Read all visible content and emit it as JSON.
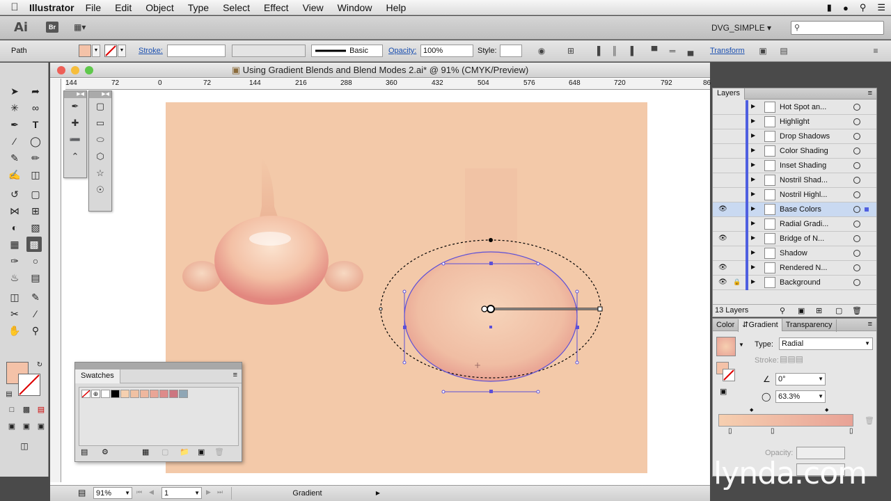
{
  "menubar": {
    "app_name": "Illustrator",
    "items": [
      "File",
      "Edit",
      "Object",
      "Type",
      "Select",
      "Effect",
      "View",
      "Window",
      "Help"
    ]
  },
  "appbar": {
    "logo": "Ai",
    "bridge": "Br",
    "workspace": "DVG_SIMPLE"
  },
  "controlbar": {
    "selection": "Path",
    "stroke_label": "Stroke:",
    "brush": "Basic",
    "opacity_label": "Opacity:",
    "opacity_value": "100%",
    "style_label": "Style:",
    "transform_label": "Transform",
    "fill_color": "#f4c2a8"
  },
  "document": {
    "title": "Using Gradient Blends and Blend Modes 2.ai* @ 91% (CMYK/Preview)",
    "ruler_ticks": [
      "144",
      "72",
      "0",
      "72",
      "144",
      "216",
      "288",
      "360",
      "432",
      "504",
      "576",
      "648",
      "720",
      "792",
      "86"
    ],
    "zoom": "91%",
    "artboard_num": "1",
    "status": "Gradient",
    "artboard_color": "#f3c9a9"
  },
  "swatches": {
    "title": "Swatches",
    "colors": [
      "#ffffff",
      "#000000",
      "#f5d0b0",
      "#f0c1a3",
      "#eeb79e",
      "#e9a596",
      "#dd8b8a",
      "#cc7680",
      "#8fa6b5"
    ]
  },
  "layers": {
    "title": "Layers",
    "count": "13 Layers",
    "rows": [
      {
        "name": "Hot Spot an...",
        "eye": false,
        "lock": false
      },
      {
        "name": "Highlight",
        "eye": false,
        "lock": false
      },
      {
        "name": "Drop Shadows",
        "eye": false,
        "lock": false
      },
      {
        "name": "Color Shading",
        "eye": false,
        "lock": false
      },
      {
        "name": "Inset Shading",
        "eye": false,
        "lock": false
      },
      {
        "name": "Nostril Shad...",
        "eye": false,
        "lock": false
      },
      {
        "name": "Nostril Highl...",
        "eye": false,
        "lock": false
      },
      {
        "name": "Base Colors",
        "eye": true,
        "lock": false,
        "selected": true
      },
      {
        "name": "Radial Gradi...",
        "eye": false,
        "lock": false
      },
      {
        "name": "Bridge of N...",
        "eye": true,
        "lock": false
      },
      {
        "name": "Shadow",
        "eye": false,
        "lock": false
      },
      {
        "name": "Rendered N...",
        "eye": true,
        "lock": false
      },
      {
        "name": "Background",
        "eye": true,
        "lock": true
      }
    ]
  },
  "gradient_panel": {
    "tabs": [
      "Color",
      "Gradient",
      "Transparency"
    ],
    "type_label": "Type:",
    "type_value": "Radial",
    "stroke_label": "Stroke:",
    "angle": "0°",
    "aspect": "63.3%",
    "opacity_label": "Opacity:",
    "gradient_start": "#f6cfb0",
    "gradient_end": "#e8a296"
  },
  "watermark": "lynda.com"
}
